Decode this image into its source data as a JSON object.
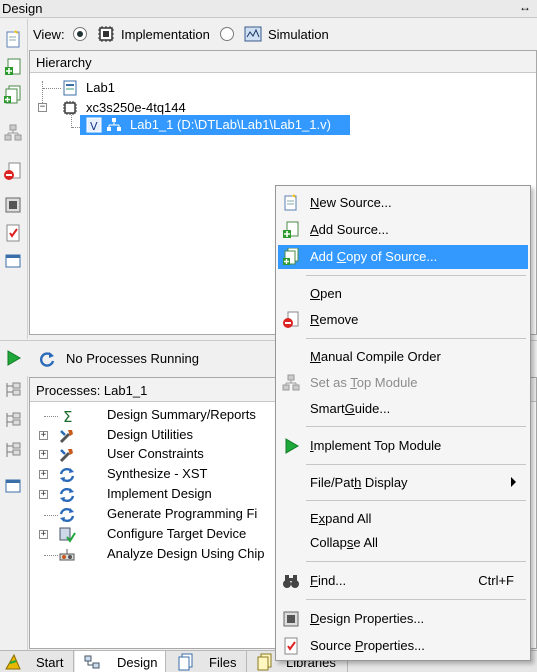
{
  "window": {
    "title": "Design",
    "resize_glyph": "↔"
  },
  "view": {
    "label": "View:",
    "options": [
      {
        "label": "Implementation",
        "selected": true
      },
      {
        "label": "Simulation",
        "selected": false
      }
    ]
  },
  "hierarchy": {
    "header": "Hierarchy",
    "items": [
      {
        "label": "Lab1",
        "icon": "project-icon"
      },
      {
        "label": "xc3s250e-4tq144",
        "icon": "chip-icon"
      },
      {
        "label": "Lab1_1 (D:\\DTLab\\Lab1\\Lab1_1.v)",
        "icon": "verilog-module-icon",
        "selected": true
      }
    ]
  },
  "processes_toolbar": {
    "status": "No Processes Running"
  },
  "processes": {
    "header": "Processes: Lab1_1",
    "items": [
      {
        "label": "Design Summary/Reports",
        "expander": false,
        "icon": "sigma-icon"
      },
      {
        "label": "Design Utilities",
        "expander": true,
        "icon": "tools-icon"
      },
      {
        "label": "User Constraints",
        "expander": true,
        "icon": "tools-icon"
      },
      {
        "label": "Synthesize - XST",
        "expander": true,
        "icon": "sync-icon"
      },
      {
        "label": "Implement Design",
        "expander": true,
        "icon": "sync-icon"
      },
      {
        "label": "Generate Programming Fi",
        "expander": false,
        "icon": "sync-icon"
      },
      {
        "label": "Configure Target Device",
        "expander": true,
        "icon": "device-icon"
      },
      {
        "label": "Analyze Design Using Chip",
        "expander": false,
        "icon": "probe-icon"
      }
    ]
  },
  "tabs": [
    {
      "label": "Start",
      "active": false
    },
    {
      "label": "Design",
      "active": true
    },
    {
      "label": "Files",
      "active": false
    },
    {
      "label": "Libraries",
      "active": false
    }
  ],
  "context_menu": {
    "items": [
      {
        "label": "New Source...",
        "ul": "N",
        "icon": "new-source-icon"
      },
      {
        "label": "Add Source...",
        "ul": "A",
        "icon": "add-source-icon"
      },
      {
        "label": "Add Copy of Source...",
        "ul": "C",
        "icon": "add-copy-source-icon",
        "highlighted": true
      },
      {
        "label": "Open",
        "ul": "O"
      },
      {
        "label": "Remove",
        "ul": "R",
        "icon": "remove-icon"
      },
      {
        "label": "Manual Compile Order",
        "ul": "M"
      },
      {
        "label": "Set as Top Module",
        "ul": "T",
        "icon": "top-module-icon",
        "disabled": true
      },
      {
        "label": "SmartGuide...",
        "ul": "G"
      },
      {
        "label": "Implement Top Module",
        "ul": "I",
        "icon": "play-icon"
      },
      {
        "label": "File/Path Display",
        "ul": "h",
        "submenu": true
      },
      {
        "label": "Expand All",
        "ul": "x"
      },
      {
        "label": "Collapse All",
        "ul": "s"
      },
      {
        "label": "Find...",
        "ul": "F",
        "icon": "binoculars-icon",
        "shortcut": "Ctrl+F"
      },
      {
        "label": "Design Properties...",
        "ul": "D",
        "icon": "design-properties-icon"
      },
      {
        "label": "Source Properties...",
        "ul": "P",
        "icon": "source-properties-icon"
      }
    ]
  },
  "colors": {
    "selection": "#3399ff",
    "run_green": "#1fa83a"
  }
}
